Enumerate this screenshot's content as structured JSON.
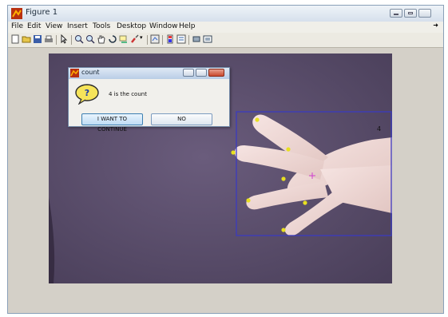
{
  "window": {
    "title": "Figure 1"
  },
  "menu": [
    "File",
    "Edit",
    "View",
    "Insert",
    "Tools",
    "Desktop",
    "Window",
    "Help"
  ],
  "menu_overflow_icon": "arrow-icon",
  "toolbar_icons": [
    "new-figure-icon",
    "open-file-icon",
    "save-icon",
    "print-icon",
    "pointer-icon",
    "zoom-in-icon",
    "zoom-out-icon",
    "pan-icon",
    "rotate-icon",
    "data-cursor-icon",
    "brush-icon",
    "brush-dropdown-icon",
    "link-plot-icon",
    "colorbar-icon",
    "legend-icon",
    "hide-plot-tools-icon",
    "show-plot-tools-icon"
  ],
  "plot": {
    "count_label": "4"
  },
  "dialog": {
    "title": "count",
    "message": "4 is the count",
    "icon": "question-icon",
    "continue_label": "I WANT TO CONTINUE",
    "no_label": "NO"
  },
  "colors": {
    "background": "#5a4d6b",
    "bbox": "#3b3bbf",
    "marker": "#e8e020",
    "centroid": "#d040d0"
  }
}
